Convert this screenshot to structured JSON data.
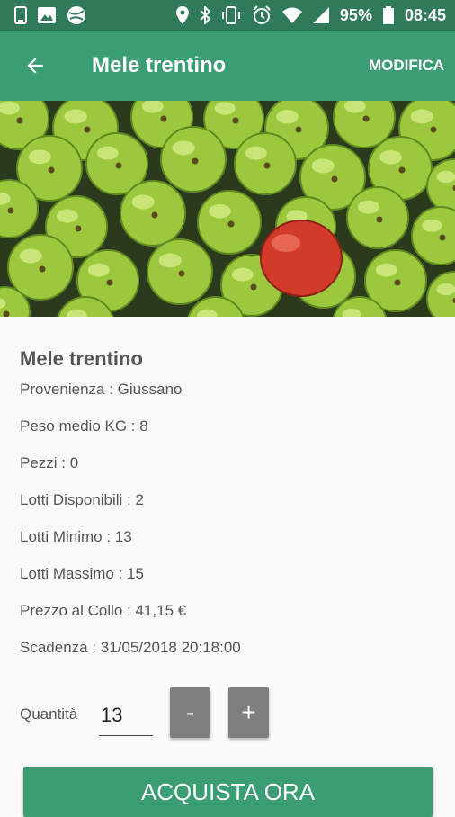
{
  "status_bar": {
    "battery": "95%",
    "time": "08:45",
    "left_icons": [
      "phone-icon",
      "image-icon",
      "ball-icon"
    ],
    "right_icons": [
      "location-icon",
      "bluetooth-icon",
      "vibrate-icon",
      "alarm-icon",
      "wifi-icon",
      "signal-icon",
      "battery-icon"
    ]
  },
  "app_bar": {
    "title": "Mele trentino",
    "action_label": "MODIFICA",
    "back_icon": "arrow-back-icon",
    "color": "#3a9e72"
  },
  "hero": {
    "icon": "apples-photo"
  },
  "product": {
    "name": "Mele trentino",
    "provenienza": "Provenienza : Giussano",
    "peso": "Peso medio KG : 8",
    "pezzi": "Pezzi : 0",
    "lotti_disponibili": "Lotti Disponibili : 2",
    "lotti_minimo": "Lotti Minimo : 13",
    "lotti_massimo": "Lotti Massimo : 15",
    "prezzo": "Prezzo al Collo :  41,15 €",
    "scadenza": "Scadenza : 31/05/2018 20:18:00"
  },
  "quantity": {
    "label": "Quantità",
    "value": "13",
    "minus_label": "-",
    "plus_label": "+"
  },
  "buy_button": {
    "label": "ACQUISTA ORA"
  }
}
